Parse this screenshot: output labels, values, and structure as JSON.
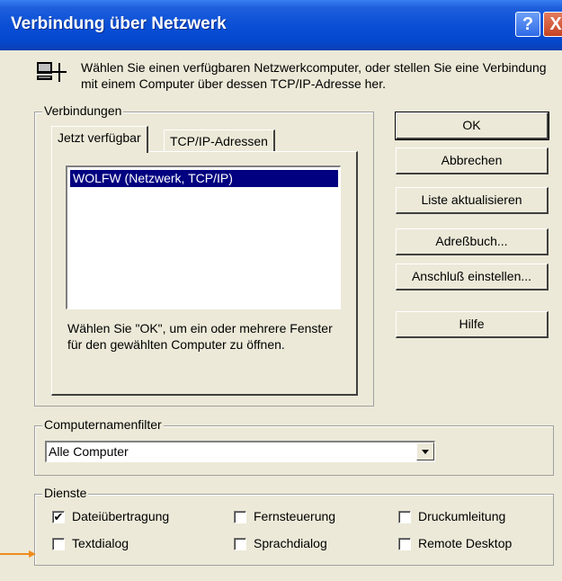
{
  "window": {
    "title": "Verbindung über Netzwerk",
    "help_glyph": "?",
    "close_glyph": "X"
  },
  "intro": {
    "icon": "network-computer-icon",
    "text": "Wählen Sie einen verfügbaren Netzwerkcomputer, oder stellen Sie eine Verbindung mit einem Computer über dessen TCP/IP-Adresse her."
  },
  "connections": {
    "label": "Verbindungen",
    "tabs": [
      "Jetzt verfügbar",
      "TCP/IP-Adressen"
    ],
    "active_tab": 0,
    "list_items": [
      "WOLFW (Netzwerk, TCP/IP)"
    ],
    "selected_index": 0,
    "hint": "Wählen Sie \"OK\", um ein oder mehrere Fenster für den gewählten Computer zu öffnen."
  },
  "buttons": {
    "ok": "OK",
    "cancel": "Abbrechen",
    "refresh": "Liste aktualisieren",
    "addressbook": "Adreßbuch...",
    "connection_settings": "Anschluß einstellen...",
    "help": "Hilfe"
  },
  "filter": {
    "label": "Computernamenfilter",
    "selected": "Alle Computer"
  },
  "services": {
    "label": "Dienste",
    "items": [
      {
        "label": "Dateiübertragung",
        "checked": true
      },
      {
        "label": "Fernsteuerung",
        "checked": false
      },
      {
        "label": "Druckumleitung",
        "checked": false
      },
      {
        "label": "Textdialog",
        "checked": false
      },
      {
        "label": "Sprachdialog",
        "checked": false
      },
      {
        "label": "Remote Desktop",
        "checked": false
      }
    ]
  },
  "colors": {
    "titlebar": "#0a4fd6",
    "dialog_bg": "#ece9d8",
    "selection": "#000080",
    "pointer_arrow": "#f08c1e"
  }
}
